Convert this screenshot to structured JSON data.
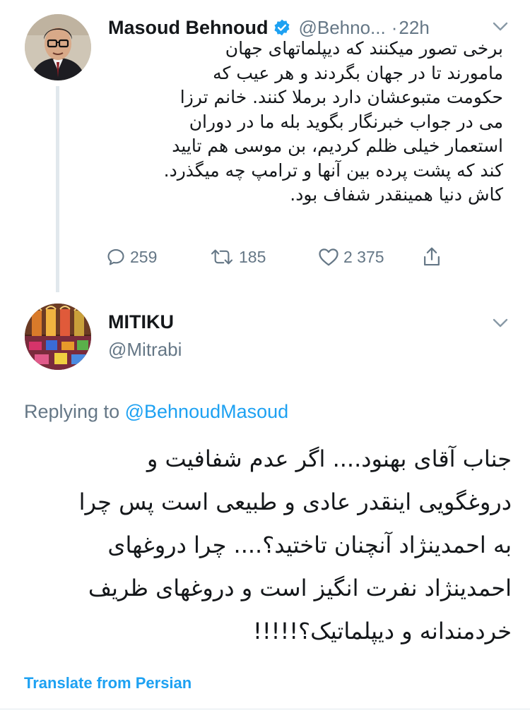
{
  "tweet": {
    "author_name": "Masoud Behnoud",
    "handle": "@Behno...",
    "separator": "·",
    "time": "22h",
    "verified": true,
    "avatar_icon": "user-avatar-photo",
    "lines": [
      "برخی تصور میکنند که دیپلماتهای جهان",
      "مامورند تا در جهان بگردند و هر عیب که",
      "حکومت متبوعشان دارد برملا کنند. خانم ترزا",
      "می در جواب خبرنگار بگوید بله ما در دوران",
      "استعمار خیلی ظلم کردیم، بن موسی هم تایید",
      "کند که پشت پرده بین آنها و ترامپ چه میگذرد.",
      "کاش دنیا همینقدر شفاف بود."
    ],
    "replies": "259",
    "retweets": "185",
    "likes": "2 375"
  },
  "reply": {
    "author_name": "MITIKU",
    "handle": "@Mitrabi",
    "avatar_icon": "mosque-interior-avatar",
    "replying_prefix": "Replying to",
    "replying_to": "@BehnoudMasoud",
    "lines": [
      "جناب آقای بهنود.... اگر عدم شفافیت و",
      "دروغگویی اینقدر عادی و طبیعی است پس چرا",
      "به احمدینژاد آنچنان تاختید؟.... چرا دروغهای",
      "احمدینژاد نفرت انگیز است و دروغهای ظریف",
      "خردمندانه و دیپلماتیک؟!!!!!"
    ],
    "translate_label": "Translate from Persian"
  },
  "colors": {
    "text": "#14171a",
    "secondary": "#657786",
    "link": "#1da1f2",
    "verified": "#1da1f2",
    "divider": "#e1e8ed"
  }
}
